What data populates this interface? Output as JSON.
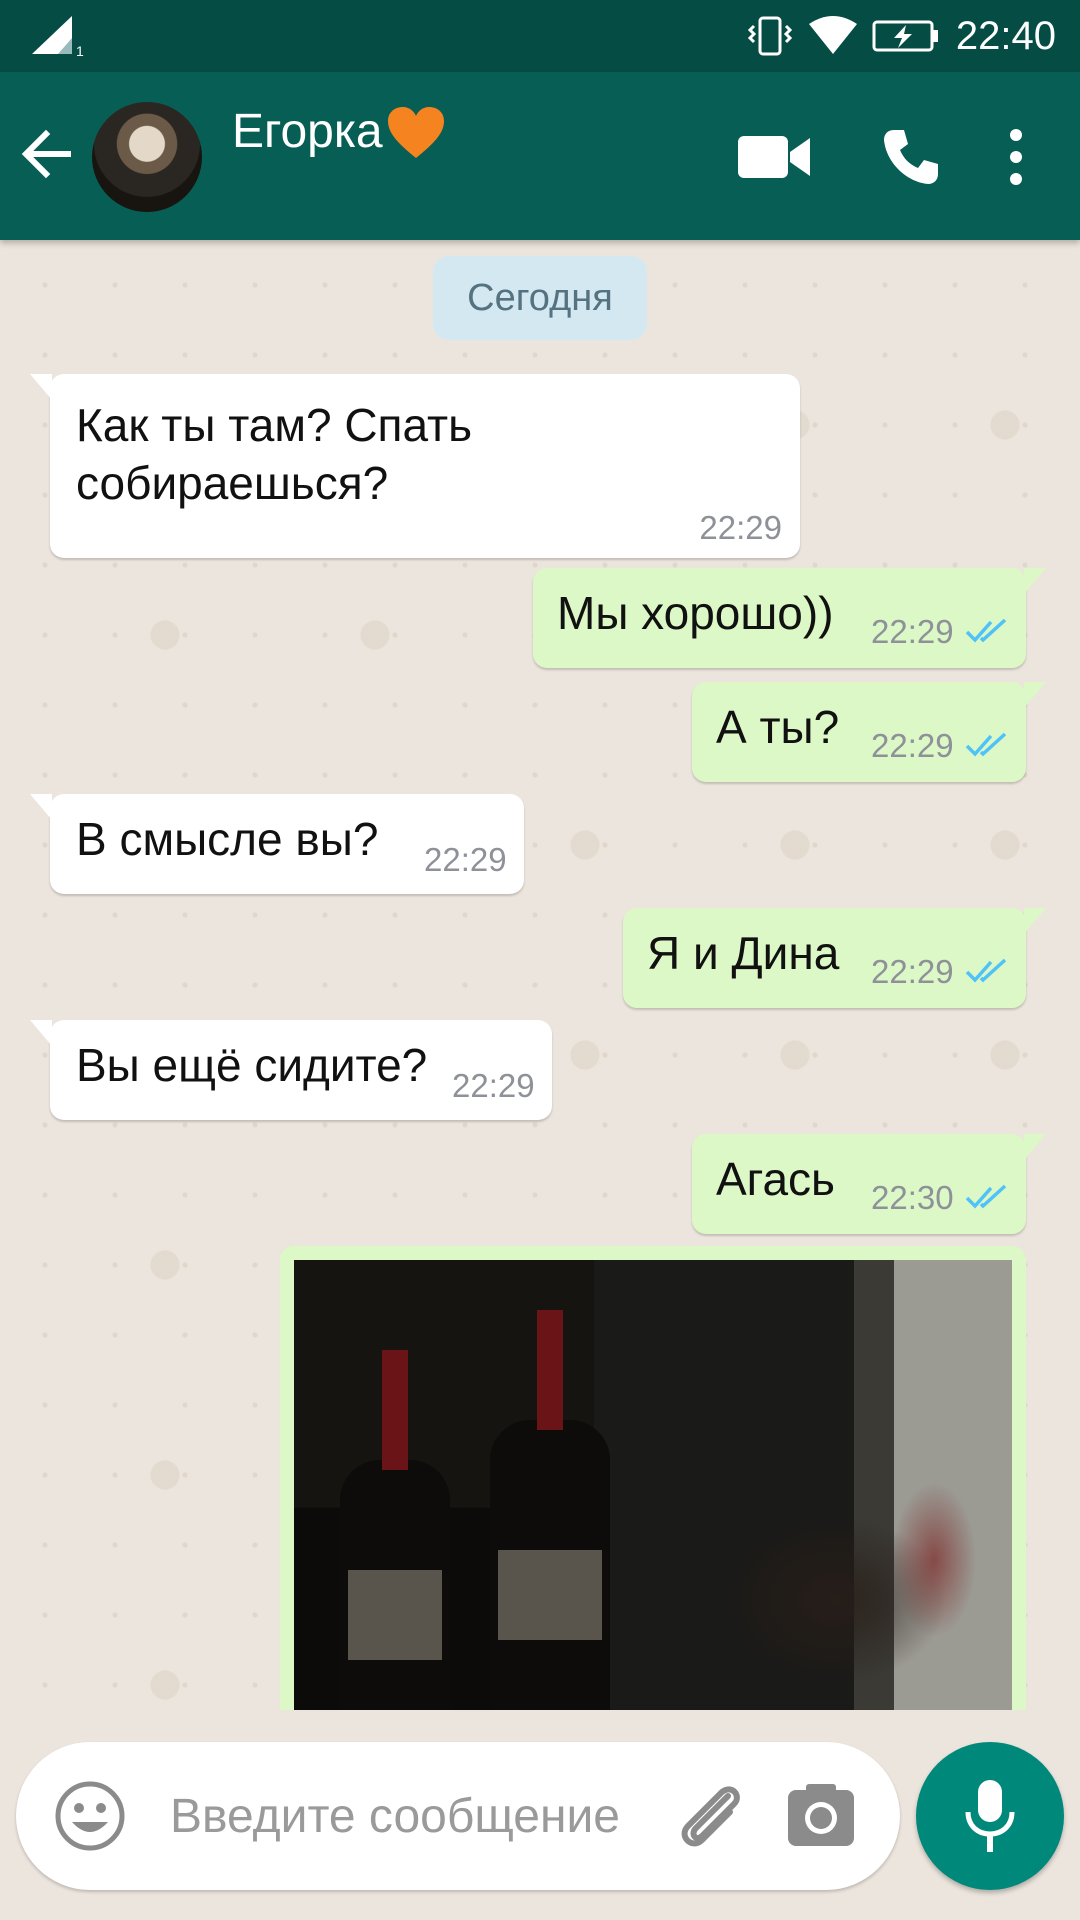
{
  "status_bar": {
    "time": "22:40",
    "sim_number": "1",
    "icons": [
      "signal-icon",
      "vibrate-icon",
      "wifi-icon",
      "battery-charging-icon"
    ]
  },
  "header": {
    "contact_name": "Егорка",
    "contact_emoji": "orange-heart",
    "actions": [
      "back-arrow-icon",
      "video-call-icon",
      "voice-call-icon",
      "more-options-icon"
    ]
  },
  "chat": {
    "date_label": "Сегодня",
    "messages": [
      {
        "direction": "in",
        "text_lines": [
          "Как ты там? Спать",
          "собираешься?"
        ],
        "time": "22:29"
      },
      {
        "direction": "out",
        "text": "Мы хорошо))",
        "time": "22:29",
        "status": "read"
      },
      {
        "direction": "out",
        "text": "А ты?",
        "time": "22:29",
        "status": "read"
      },
      {
        "direction": "in",
        "text": "В смысле вы?",
        "time": "22:29"
      },
      {
        "direction": "out",
        "text": "Я и Дина",
        "time": "22:29",
        "status": "read"
      },
      {
        "direction": "in",
        "text": "Вы ещё сидите?",
        "time": "22:29"
      },
      {
        "direction": "out",
        "text": "Агась",
        "time": "22:30",
        "status": "read"
      },
      {
        "direction": "out",
        "type": "image",
        "description_icon": "photo-wine-bottles"
      }
    ]
  },
  "composer": {
    "placeholder": "Введите сообщение",
    "value": ""
  },
  "colors": {
    "header_bg": "#075e54",
    "status_bg": "#054d44",
    "out_bubble": "#dcf8c6",
    "in_bubble": "#ffffff",
    "read_ticks": "#4fc3f7",
    "fab": "#00897b",
    "heart": "#f5831f"
  }
}
